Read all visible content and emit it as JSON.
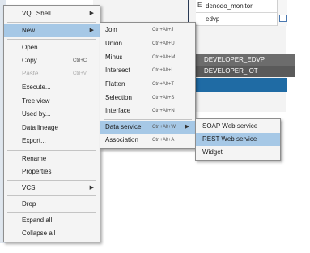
{
  "background": {
    "rows": [
      {
        "text": "denodo_monitor"
      },
      {
        "text": "edvp"
      }
    ],
    "bands": [
      {
        "text": "DEVELOPER_EDVP"
      },
      {
        "text": "DEVELOPER_IOT"
      }
    ],
    "fragment": "E"
  },
  "context_menu": {
    "items": [
      {
        "label": "VQL Shell",
        "shortcut": "",
        "submenu": true
      },
      {
        "label": "New",
        "shortcut": "",
        "submenu": true,
        "selected": true
      },
      {
        "label": "Open...",
        "shortcut": ""
      },
      {
        "label": "Copy",
        "shortcut": "Ctrl+C"
      },
      {
        "label": "Paste",
        "shortcut": "Ctrl+V",
        "disabled": true
      },
      {
        "label": "Execute...",
        "shortcut": ""
      },
      {
        "label": "Tree view",
        "shortcut": ""
      },
      {
        "label": "Used by...",
        "shortcut": ""
      },
      {
        "label": "Data lineage",
        "shortcut": ""
      },
      {
        "label": "Export...",
        "shortcut": ""
      },
      {
        "label": "Rename",
        "shortcut": ""
      },
      {
        "label": "Properties",
        "shortcut": ""
      },
      {
        "label": "VCS",
        "shortcut": "",
        "submenu": true
      },
      {
        "label": "Drop",
        "shortcut": ""
      },
      {
        "label": "Expand all",
        "shortcut": ""
      },
      {
        "label": "Collapse all",
        "shortcut": ""
      }
    ]
  },
  "new_submenu": {
    "items": [
      {
        "label": "Join",
        "shortcut": "Ctrl+Alt+J"
      },
      {
        "label": "Union",
        "shortcut": "Ctrl+Alt+U"
      },
      {
        "label": "Minus",
        "shortcut": "Ctrl+Alt+M"
      },
      {
        "label": "Intersect",
        "shortcut": "Ctrl+Alt+I"
      },
      {
        "label": "Flatten",
        "shortcut": "Ctrl+Alt+T"
      },
      {
        "label": "Selection",
        "shortcut": "Ctrl+Alt+S"
      },
      {
        "label": "Interface",
        "shortcut": "Ctrl+Alt+N"
      },
      {
        "label": "Data service",
        "shortcut": "Ctrl+Alt+W",
        "submenu": true,
        "selected": true
      },
      {
        "label": "Association",
        "shortcut": "Ctrl+Alt+A"
      }
    ]
  },
  "data_service_submenu": {
    "items": [
      {
        "label": "SOAP Web service"
      },
      {
        "label": "REST Web service",
        "selected": true
      },
      {
        "label": "Widget"
      }
    ]
  },
  "colors": {
    "selection": "#a6c8e6",
    "menu_background": "#f4f4f4",
    "header_blue": "#1f6ba4"
  },
  "icons": {
    "submenu_arrow": "triangle-right-icon",
    "checkbox": "checkbox-icon"
  }
}
